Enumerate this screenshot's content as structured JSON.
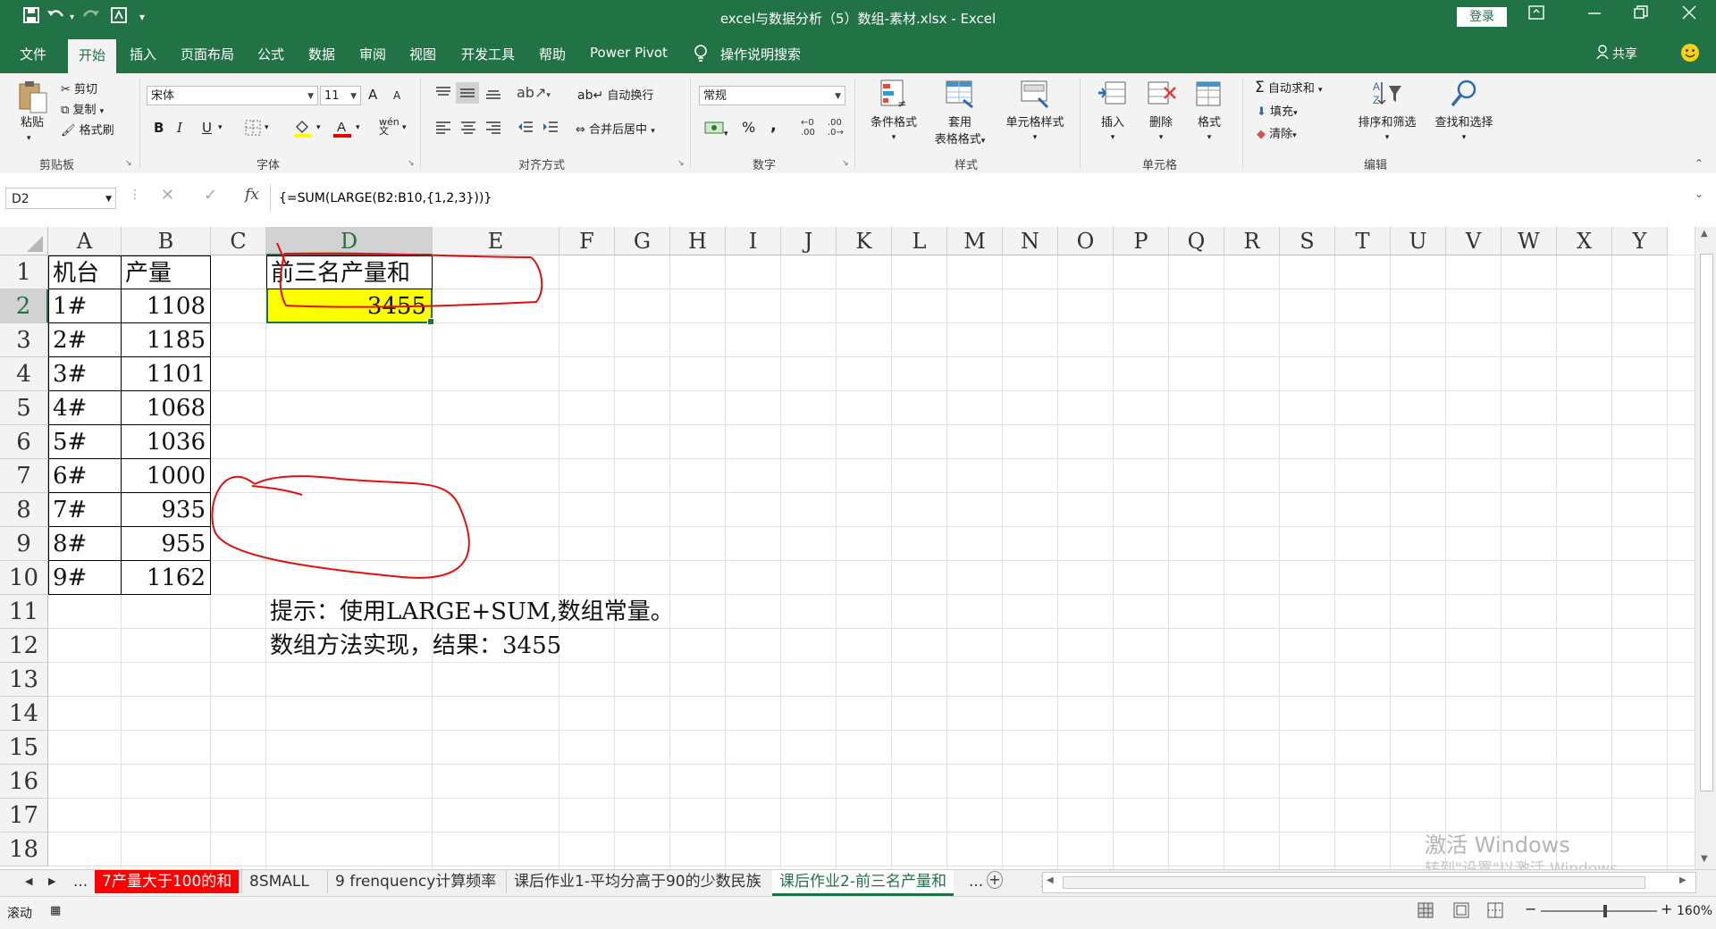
{
  "window": {
    "title": "excel与数据分析（5）数组-素材.xlsx  -  Excel",
    "login_label": "登录",
    "accent_color": "#217346"
  },
  "quick_access": {
    "save_icon": "save-icon",
    "undo_icon": "undo-icon",
    "redo_icon": "redo-icon",
    "touch_icon": "touch-mode-icon",
    "more_icon": "customize-qat-icon"
  },
  "tabs": [
    "文件",
    "开始",
    "插入",
    "页面布局",
    "公式",
    "数据",
    "审阅",
    "视图",
    "开发工具",
    "帮助",
    "Power Pivot",
    "操作说明搜索"
  ],
  "share_label": "共享",
  "ribbon": {
    "clipboard": {
      "paste": "粘贴",
      "cut": "剪切",
      "copy": "复制",
      "format_painter": "格式刷",
      "group": "剪贴板"
    },
    "font": {
      "name": "宋体",
      "size": "11",
      "bold": "B",
      "italic": "I",
      "underline": "U",
      "grow": "A",
      "shrink": "A",
      "group": "字体",
      "phonetic": "wén"
    },
    "alignment": {
      "wrap": "自动换行",
      "merge": "合并后居中",
      "group": "对齐方式"
    },
    "number": {
      "format": "常规",
      "percent": "%",
      "comma": ",",
      "group": "数字",
      "inc_decimal": ".00",
      "dec_decimal": ".0"
    },
    "styles": {
      "conditional": "条件格式",
      "table1": "套用",
      "table2": "表格格式",
      "cell_styles": "单元格样式",
      "group": "样式"
    },
    "cells": {
      "insert": "插入",
      "delete": "删除",
      "format": "格式",
      "group": "单元格"
    },
    "editing": {
      "autosum": "自动求和",
      "fill": "填充",
      "clear": "清除",
      "sort": "排序和筛选",
      "find": "查找和选择",
      "group": "编辑"
    }
  },
  "formula_bar": {
    "name_box": "D2",
    "formula": "{=SUM(LARGE(B2:B10,{1,2,3}))}",
    "cancel": "✕",
    "enter": "✓",
    "fx": "fx"
  },
  "columns": [
    "A",
    "B",
    "C",
    "D",
    "E",
    "F",
    "G",
    "H",
    "I",
    "J",
    "K",
    "L",
    "M",
    "N",
    "O",
    "P",
    "Q",
    "R",
    "S",
    "T",
    "U",
    "V",
    "W",
    "X",
    "Y"
  ],
  "rows": [
    "1",
    "2",
    "3",
    "4",
    "5",
    "6",
    "7",
    "8",
    "9",
    "10",
    "11",
    "12",
    "13",
    "14",
    "15",
    "16",
    "17",
    "18"
  ],
  "table": {
    "headers": [
      "机台",
      "产量"
    ],
    "machines": [
      "1#",
      "2#",
      "3#",
      "4#",
      "5#",
      "6#",
      "7#",
      "8#",
      "9#"
    ],
    "outputs": [
      "1108",
      "1185",
      "1101",
      "1068",
      "1036",
      "1000",
      "935",
      "955",
      "1162"
    ]
  },
  "result": {
    "header": "前三名产量和",
    "value": "3455",
    "fill": "#ffff00"
  },
  "notes": [
    "提示：使用LARGE+SUM,数组常量。",
    "数组方法实现，结果：3455"
  ],
  "sheet_tabs": [
    {
      "label": "7产量大于100的和",
      "style": "red"
    },
    {
      "label": "8SMALL",
      "style": "normal"
    },
    {
      "label": "9 frenquency计算频率",
      "style": "normal"
    },
    {
      "label": "课后作业1-平均分高于90的少数民族",
      "style": "normal"
    },
    {
      "label": "课后作业2-前三名产量和",
      "style": "active"
    }
  ],
  "sheet_nav": {
    "prev": "◀",
    "next": "▶",
    "more": "...",
    "more_right": "...",
    "add": "+"
  },
  "status": {
    "mode": "滚动",
    "zoom": "160%",
    "minus": "−",
    "plus": "+"
  },
  "watermark": {
    "line1": "激活 Windows",
    "line2": "转到\"设置\"以激活 Windows。"
  }
}
